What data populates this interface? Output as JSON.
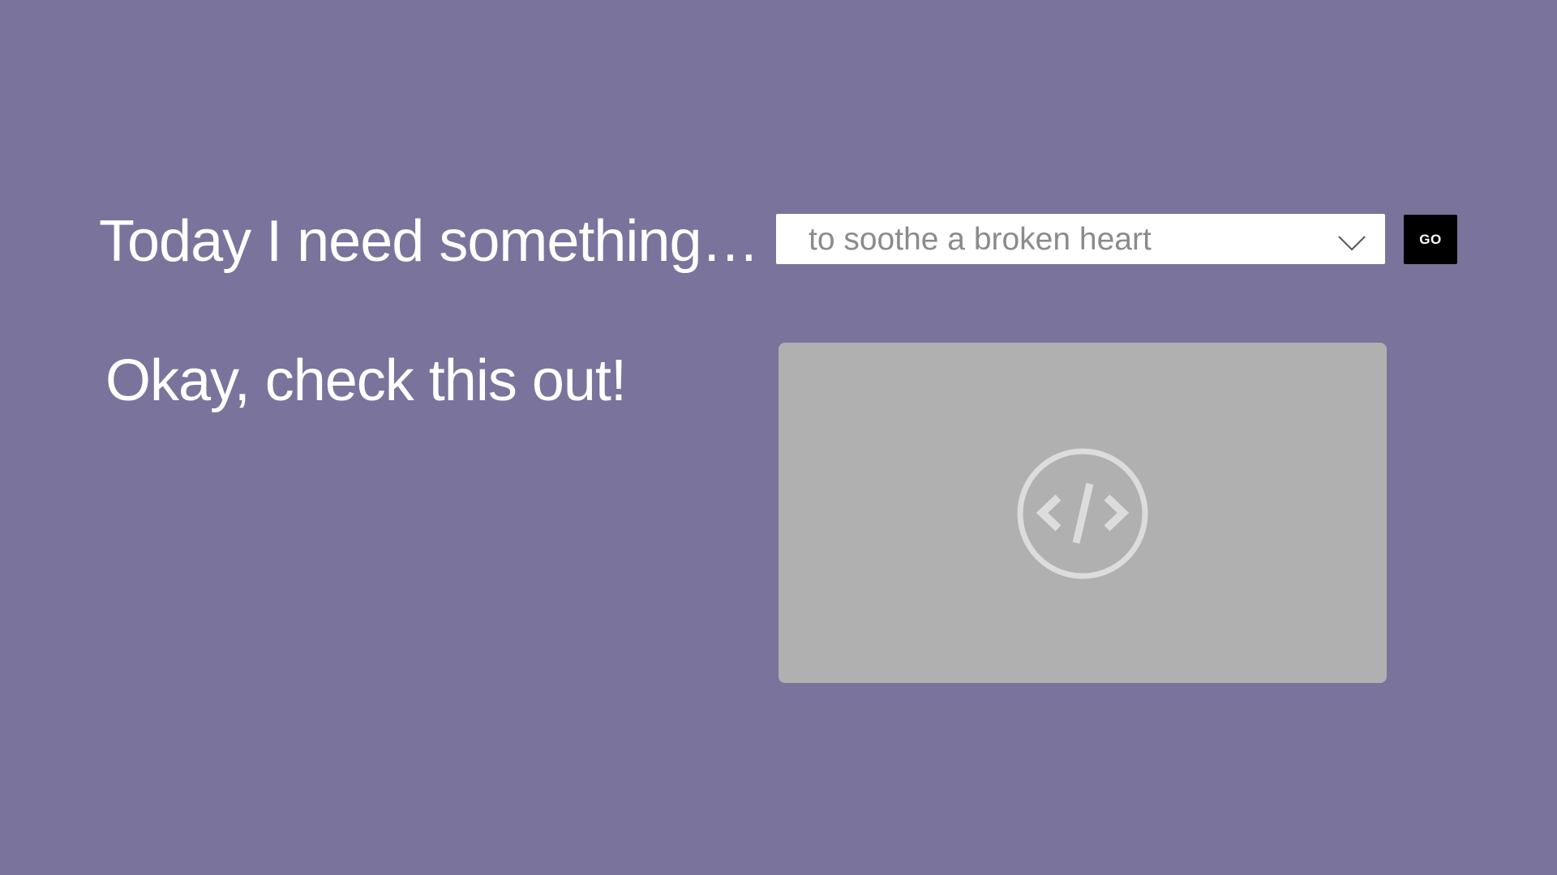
{
  "header": {
    "prompt_text": "Today I need something…"
  },
  "selector": {
    "selected_value": "to soothe a broken heart",
    "chevron_icon": "chevron-down-icon"
  },
  "go_button": {
    "label": "GO"
  },
  "result": {
    "heading": "Okay, check this out!",
    "embed_icon": "code-icon"
  },
  "colors": {
    "background": "#7a739b",
    "select_background": "#ffffff",
    "select_text": "#8b8b8b",
    "button_background": "#000000",
    "embed_background": "#b0b0b0",
    "embed_icon": "#dcdcdc"
  }
}
